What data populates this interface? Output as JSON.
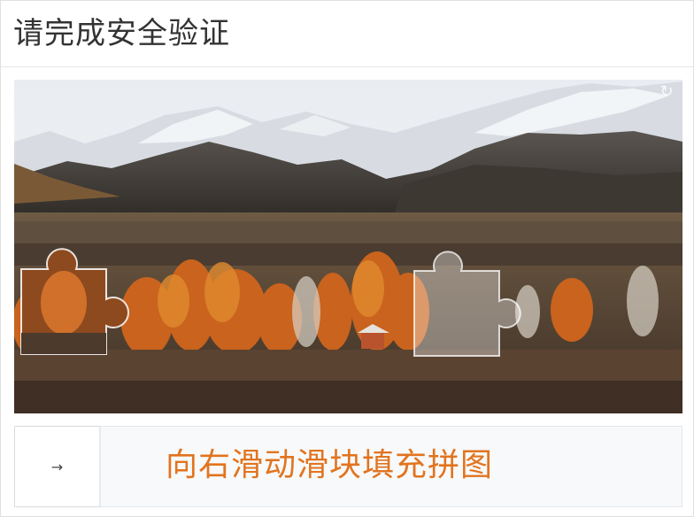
{
  "dialog": {
    "title": "请完成安全验证"
  },
  "captcha": {
    "refresh_icon": "refresh-icon",
    "slider_arrow": "→",
    "slider_hint": "向右滑动滑块填充拼图",
    "hint_color": "#e2741f"
  }
}
